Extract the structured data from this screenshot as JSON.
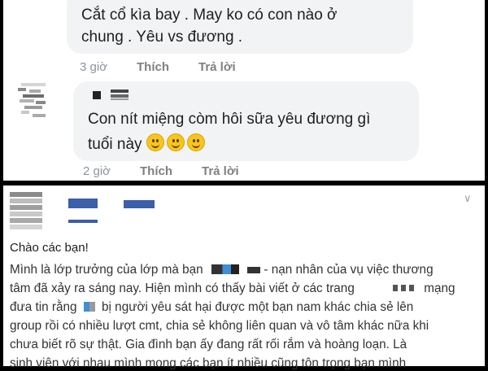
{
  "comment1": {
    "line1": "Cắt cổ kìa bay . May ko có con nào ở",
    "line2": "chung . Yêu vs đương .",
    "time": "3 giờ",
    "like": "Thích",
    "reply": "Trả lời"
  },
  "comment2": {
    "line1": "Con nít miệng còm hôi sữa yêu đương gì",
    "line2": "tuổi này",
    "emojis": [
      "smile-emoji",
      "smile-emoji",
      "smile-emoji"
    ],
    "time": "2 giờ",
    "like": "Thích",
    "reply": "Trả lời"
  },
  "post": {
    "greeting": "Chào các bạn!",
    "lines": [
      "Mình là lớp trưởng của lớp mà bạn",
      "- nạn nhân của vụ việc thương",
      "tâm đã xảy ra sáng nay. Hiện mình có thấy bài viết ở các trang",
      "mạng",
      "đưa tin rằng",
      "bị người yêu sát hại được một bạn nam khác chia sẻ lên",
      "group rồi có nhiều lượt cmt, chia sẻ không liên quan và vô tâm khác nữa khi",
      "chưa biết rõ sự thật. Gia đình bạn ấy đang rất rối rắm và hoàng loạn. Là",
      "sinh viên với nhau mình mong các bạn ít nhiều cũng tôn trọng bạn mình"
    ],
    "chevron": "chevron-down-icon"
  }
}
